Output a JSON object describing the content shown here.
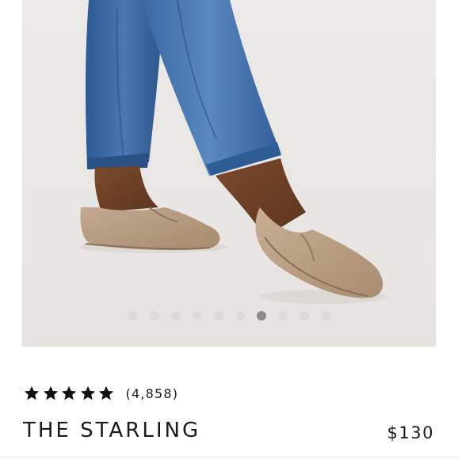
{
  "product": {
    "name": "THE STARLING",
    "price": "$130",
    "review_count": "(4,858)",
    "rating": 5,
    "rating_max": 5
  },
  "gallery": {
    "image_alt": "product-photo-tan-suede-loafers",
    "slide_count": 10,
    "active_slide": 7
  },
  "colors": {
    "photo_bg": "#ebe9e7",
    "suede": "#b49b83",
    "denim": "#3c6aa3",
    "star": "#111111"
  }
}
